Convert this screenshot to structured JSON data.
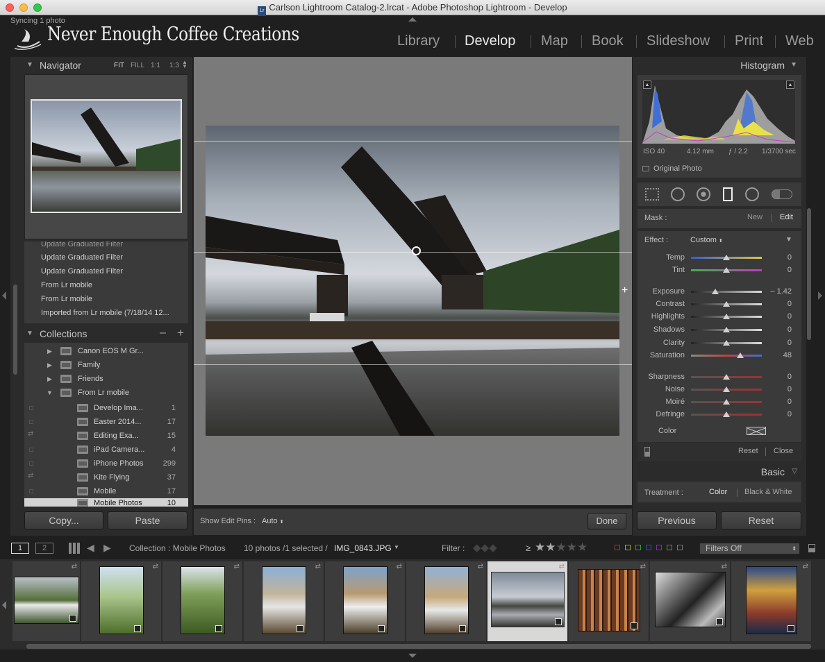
{
  "window": {
    "title": "Carlson Lightroom Catalog-2.lrcat - Adobe Photoshop Lightroom - Develop"
  },
  "identity": {
    "sync_status": "Syncing 1 photo",
    "brand": "Never Enough Coffee Creations"
  },
  "modules": [
    "Library",
    "Develop",
    "Map",
    "Book",
    "Slideshow",
    "Print",
    "Web"
  ],
  "navigator": {
    "title": "Navigator",
    "zoom_options": [
      "FIT",
      "FILL",
      "1:1",
      "1:3"
    ]
  },
  "history": [
    "Update Graduated Filter",
    "Update Graduated Filter",
    "Update Graduated Filter",
    "From Lr mobile",
    "From Lr mobile",
    "Imported from Lr mobile (7/18/14 12..."
  ],
  "collections": {
    "title": "Collections",
    "minus": "–",
    "plus": "+",
    "sets": [
      {
        "name": "Canon EOS M Gr...",
        "expanded": false
      },
      {
        "name": "Family",
        "expanded": false
      },
      {
        "name": "Friends",
        "expanded": false
      },
      {
        "name": "From Lr mobile",
        "expanded": true
      }
    ],
    "children": [
      {
        "name": "Develop Ima...",
        "count": "1"
      },
      {
        "name": "Easter 2014...",
        "count": "17"
      },
      {
        "name": "Editing Exa...",
        "count": "15"
      },
      {
        "name": "iPad Camera...",
        "count": "4"
      },
      {
        "name": "iPhone Photos",
        "count": "299"
      },
      {
        "name": "Kite Flying",
        "count": "37"
      },
      {
        "name": "Mobile",
        "count": "17"
      },
      {
        "name": "Mobile Photos",
        "count": "10"
      }
    ]
  },
  "left_buttons": {
    "copy": "Copy...",
    "paste": "Paste"
  },
  "toolbar": {
    "edit_pins_label": "Show Edit Pins :",
    "edit_pins_value": "Auto",
    "done": "Done"
  },
  "histogram": {
    "title": "Histogram",
    "iso": "ISO 40",
    "focal": "4.12 mm",
    "aperture": "ƒ / 2.2",
    "shutter": "1/3700 sec",
    "original_photo": "Original Photo"
  },
  "mask": {
    "label": "Mask :",
    "new": "New",
    "edit": "Edit"
  },
  "effect": {
    "label": "Effect :",
    "value": "Custom"
  },
  "sliders": [
    {
      "label": "Temp",
      "value": "0",
      "pos": 0.5,
      "kind": "temp"
    },
    {
      "label": "Tint",
      "value": "0",
      "pos": 0.5,
      "kind": "tint"
    },
    {
      "label": "Exposure",
      "value": "– 1.42",
      "pos": 0.34,
      "kind": "gray"
    },
    {
      "label": "Contrast",
      "value": "0",
      "pos": 0.5,
      "kind": "gray"
    },
    {
      "label": "Highlights",
      "value": "0",
      "pos": 0.5,
      "kind": "gray"
    },
    {
      "label": "Shadows",
      "value": "0",
      "pos": 0.5,
      "kind": "gray"
    },
    {
      "label": "Clarity",
      "value": "0",
      "pos": 0.5,
      "kind": "gray"
    },
    {
      "label": "Saturation",
      "value": "48",
      "pos": 0.7,
      "kind": "sat"
    },
    {
      "label": "Sharpness",
      "value": "0",
      "pos": 0.5,
      "kind": "red"
    },
    {
      "label": "Noise",
      "value": "0",
      "pos": 0.5,
      "kind": "red"
    },
    {
      "label": "Moiré",
      "value": "0",
      "pos": 0.5,
      "kind": "red"
    },
    {
      "label": "Defringe",
      "value": "0",
      "pos": 0.5,
      "kind": "red"
    }
  ],
  "color_row": {
    "label": "Color"
  },
  "panel_footer": {
    "reset": "Reset",
    "close": "Close"
  },
  "basic": {
    "title": "Basic",
    "treatment_label": "Treatment :",
    "color": "Color",
    "bw": "Black & White"
  },
  "right_buttons": {
    "previous": "Previous",
    "reset": "Reset"
  },
  "filmstrip_bar": {
    "screen1": "1",
    "screen2": "2",
    "source": "Collection : Mobile Photos",
    "count": "10 photos /1 selected /",
    "filename": "IMG_0843.JPG",
    "filter_label": "Filter :",
    "rating_op": "≥",
    "filters_off": "Filters Off"
  },
  "colors": {
    "accent_yellow": "#e8e14a",
    "accent_blue": "#3f6fd6",
    "selected_cell": "#d8d8d8"
  }
}
